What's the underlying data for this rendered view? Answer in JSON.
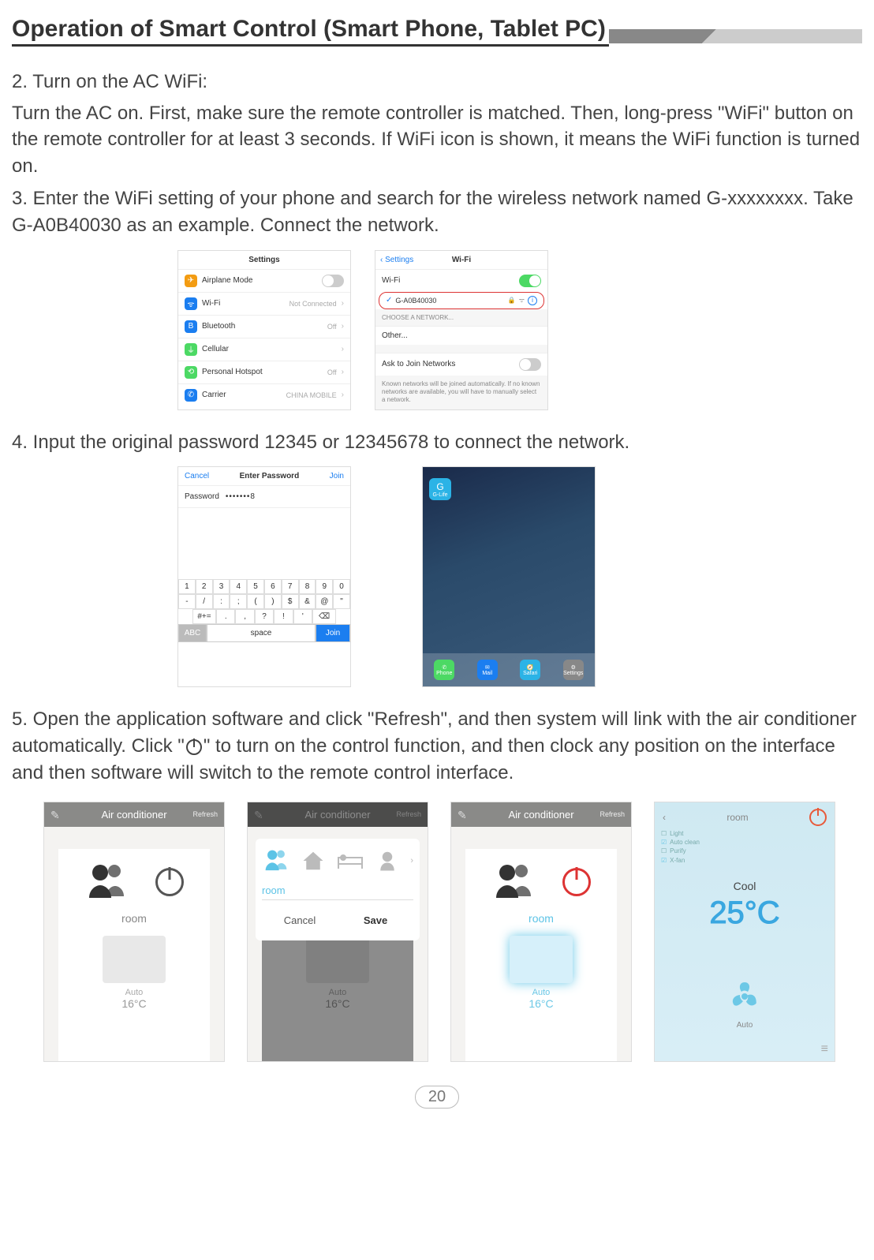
{
  "page": {
    "title": "Operation of Smart Control (Smart Phone, Tablet PC)",
    "number": "20"
  },
  "steps": {
    "s2_heading": "2. Turn on the AC WiFi:",
    "s2_body": "Turn the AC on. First, make sure the remote controller is matched. Then, long-press \"WiFi\" button on the remote controller for at least 3 seconds. If WiFi icon is shown,  it means the WiFi function is turned on.",
    "s3": "3. Enter the WiFi setting of your phone and search for the wireless network named G-xxxxxxxx. Take G-A0B40030 as an example. Connect the network.",
    "s4": "4. Input the original password 12345 or 12345678 to connect the network.",
    "s5_a": "5. Open the application software and click \"Refresh\", and then system will link with the air conditioner automatically. Click \"",
    "s5_b": "\" to turn on the control function, and then clock any position on the interface and then software will switch to the remote control interface."
  },
  "settings_screen": {
    "title": "Settings",
    "rows": {
      "airplane": {
        "label": "Airplane Mode"
      },
      "wifi": {
        "label": "Wi-Fi",
        "value": "Not Connected"
      },
      "bt": {
        "label": "Bluetooth",
        "value": "Off"
      },
      "cell": {
        "label": "Cellular"
      },
      "hotspot": {
        "label": "Personal Hotspot",
        "value": "Off"
      },
      "carrier": {
        "label": "Carrier",
        "value": "CHINA MOBILE"
      }
    }
  },
  "wifi_screen": {
    "back": "Settings",
    "title": "Wi-Fi",
    "wifi_label": "Wi-Fi",
    "selected_network": "G-A0B40030",
    "choose": "CHOOSE A NETWORK...",
    "other": "Other...",
    "ask": "Ask to Join Networks",
    "note": "Known networks will be joined automatically. If no known networks are available, you will have to manually select a network."
  },
  "password_screen": {
    "cancel": "Cancel",
    "title": "Enter Password",
    "join": "Join",
    "label": "Password",
    "dots": "•••••••8",
    "kbd_row1": [
      "1",
      "2",
      "3",
      "4",
      "5",
      "6",
      "7",
      "8",
      "9",
      "0"
    ],
    "kbd_row2": [
      "-",
      "/",
      ":",
      ";",
      "(",
      ")",
      "$",
      "&",
      "@",
      "\""
    ],
    "kbd_row3": [
      ".",
      ",",
      "?",
      "!",
      "'"
    ],
    "abc": "ABC",
    "space": "space",
    "join_btn": "Join"
  },
  "home_screen": {
    "app": "G-Life",
    "dock": [
      "Phone",
      "Mail",
      "Safari",
      "Settings"
    ]
  },
  "ac_app": {
    "header": "Air conditioner",
    "refresh": "Refresh",
    "room": "room",
    "auto": "Auto",
    "temp": "16°C",
    "overlay": {
      "room_input": "room",
      "cancel": "Cancel",
      "save": "Save"
    }
  },
  "room_screen": {
    "title": "room",
    "modes": [
      "Light",
      "Auto clean",
      "Purify",
      "X-fan"
    ],
    "mode_label": "Cool",
    "temp": "25°C",
    "auto": "Auto"
  }
}
